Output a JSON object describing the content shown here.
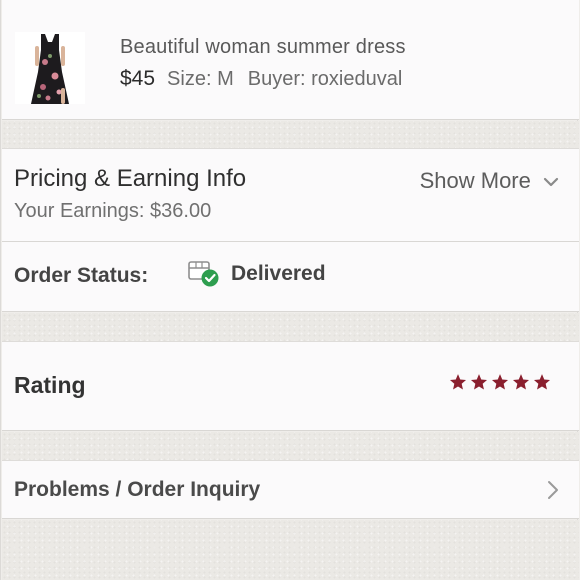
{
  "product": {
    "thumbnail_icon": "dress-photo",
    "title": "Beautiful woman summer dress",
    "price": "$45",
    "size_label": "Size:",
    "size_value": "M",
    "buyer_label": "Buyer:",
    "buyer_value": "roxieduval"
  },
  "pricing": {
    "title": "Pricing & Earning Info",
    "earnings_label": "Your Earnings:",
    "earnings_value": "$36.00",
    "show_more_label": "Show More",
    "show_more_icon": "chevron-down-icon"
  },
  "order_status": {
    "label": "Order Status:",
    "value": "Delivered",
    "icon": "delivered-box-check-icon",
    "check_color": "#2e9e4f"
  },
  "rating": {
    "label": "Rating",
    "stars": 5,
    "max_stars": 5,
    "star_color": "#8a1f2e"
  },
  "problems": {
    "label": "Problems / Order Inquiry",
    "icon": "chevron-right-icon"
  }
}
